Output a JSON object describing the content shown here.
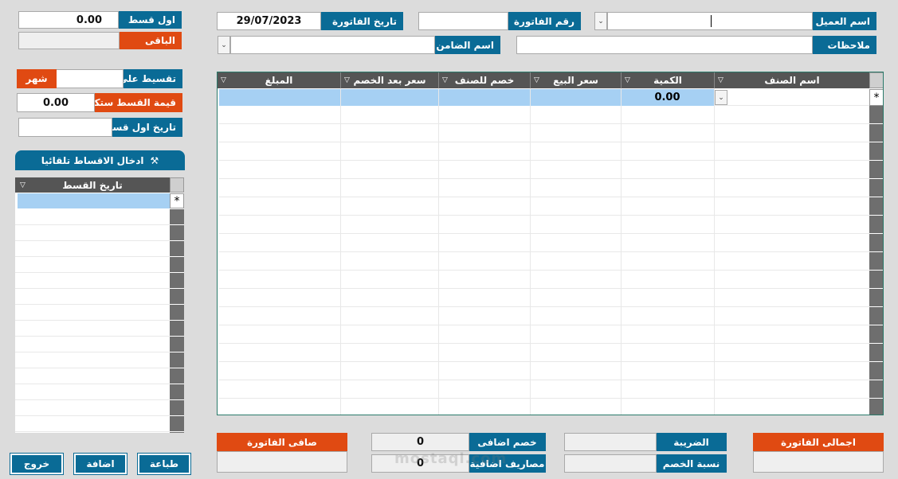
{
  "header": {
    "customer_label": "اسم العميل",
    "customer_value": "",
    "invoice_no_label": "رقم الفاتورة",
    "invoice_no_value": "",
    "invoice_date_label": "تاريخ الفاتورة",
    "invoice_date_value": "29/07/2023",
    "notes_label": "ملاحظات",
    "notes_value": "",
    "guarantor_label": "اسم الضامن",
    "guarantor_value": ""
  },
  "installments": {
    "first_label": "اول قسط",
    "first_value": "0.00",
    "remaining_label": "الباقى",
    "remaining_value": "",
    "split_label": "تقسيط على",
    "split_value": "",
    "split_unit": "شهر",
    "amount_label": "قيمة القسط ستكون",
    "amount_value": "0.00",
    "first_date_label": "تاريخ اول قسط",
    "first_date_value": "",
    "auto_button": "ادخال الاقساط تلقائيا",
    "grid_header": "تاريخ القسط",
    "new_row_marker": "*"
  },
  "grid": {
    "columns": [
      "اسم الصنف",
      "الكمية",
      "سعر البيع",
      "خصم للصنف",
      "سعر بعد الخصم",
      "المبلغ"
    ],
    "new_row_marker": "*",
    "new_row_quantity": "0.00"
  },
  "totals": {
    "invoice_total_label": "اجمالى الفاتورة",
    "invoice_total_value": "",
    "tax_label": "الضريبة",
    "tax_value": "",
    "discount_rate_label": "نسبة الخصم",
    "discount_rate_value": "",
    "extra_discount_label": "خصم اضافى",
    "extra_discount_value": "0",
    "extra_expenses_label": "مصاريف اضافية",
    "extra_expenses_value": "0",
    "net_label": "صافى الفاتورة",
    "net_value": ""
  },
  "buttons": {
    "exit": "خروج",
    "add": "اضافة",
    "print": "طباعة"
  },
  "watermark": "mostaql.com",
  "colors": {
    "blue": "#0a6b96",
    "orange": "#e04a12",
    "selected_row": "#a6d0f3"
  }
}
